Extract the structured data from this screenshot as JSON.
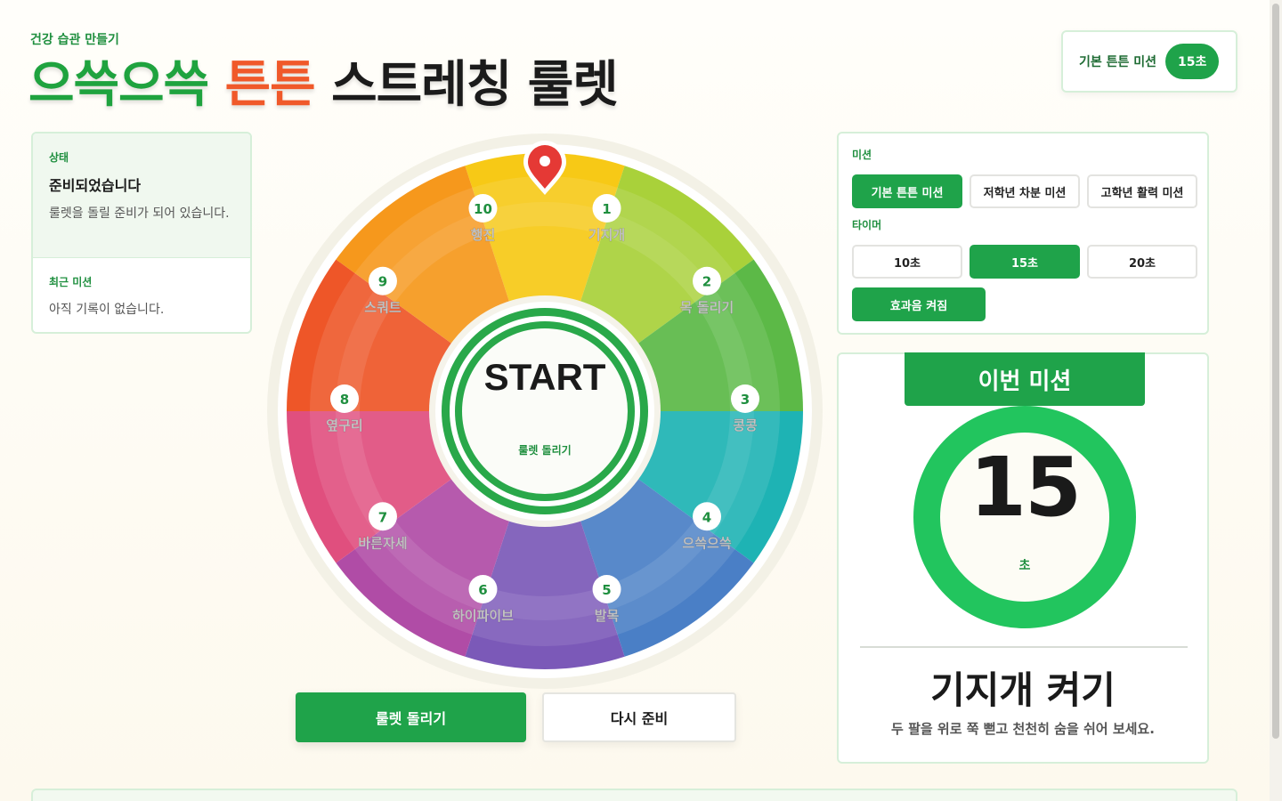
{
  "header": {
    "eyebrow": "건강 습관 만들기",
    "title_part1": "으쓱으쓱",
    "title_part2": "튼튼",
    "title_part3": "스트레칭 룰렛",
    "badge_label": "기본 튼튼 미션",
    "badge_value": "15초"
  },
  "status": {
    "label": "상태",
    "title": "준비되었습니다",
    "desc": "룰렛을 돌릴 준비가 되어 있습니다.",
    "recent_label": "최근 미션",
    "recent_desc": "아직 기록이 없습니다."
  },
  "wheel": {
    "center_label": "START",
    "center_sub": "룰렛 돌리기",
    "pointer_icon": "map-pin-icon",
    "segments": [
      {
        "num": "1",
        "label": "기지개"
      },
      {
        "num": "2",
        "label": "목 돌리기"
      },
      {
        "num": "3",
        "label": "콩콩"
      },
      {
        "num": "4",
        "label": "으쓱으쓱"
      },
      {
        "num": "5",
        "label": "발목"
      },
      {
        "num": "6",
        "label": "하이파이브"
      },
      {
        "num": "7",
        "label": "바른자세"
      },
      {
        "num": "8",
        "label": "옆구리"
      },
      {
        "num": "9",
        "label": "스쿼트"
      },
      {
        "num": "10",
        "label": "행진"
      }
    ],
    "colors": [
      "#f7c916",
      "#a9d13a",
      "#5cb947",
      "#1eb3b4",
      "#4a7fc6",
      "#7b59b8",
      "#b04ca6",
      "#e04f7e",
      "#ee5628",
      "#f6981c"
    ]
  },
  "actions": {
    "spin_label": "룰렛 돌리기",
    "reset_label": "다시 준비"
  },
  "settings": {
    "mission_label": "미션",
    "missions": [
      "기본 튼튼 미션",
      "저학년 차분 미션",
      "고학년 활력 미션"
    ],
    "timer_label": "타이머",
    "timers": [
      "10초",
      "15초",
      "20초"
    ],
    "sound_label": "효과음 켜짐"
  },
  "mission_card": {
    "header": "이번 미션",
    "timer_value": "15",
    "timer_unit": "초",
    "name": "기지개 켜기",
    "desc": "두 팔을 위로 쭉 뻗고 천천히 숨을 쉬어 보세요."
  },
  "colors": {
    "accent": "#1fa34a",
    "orange": "#f0592a",
    "timer_ring": "#22c55e"
  }
}
